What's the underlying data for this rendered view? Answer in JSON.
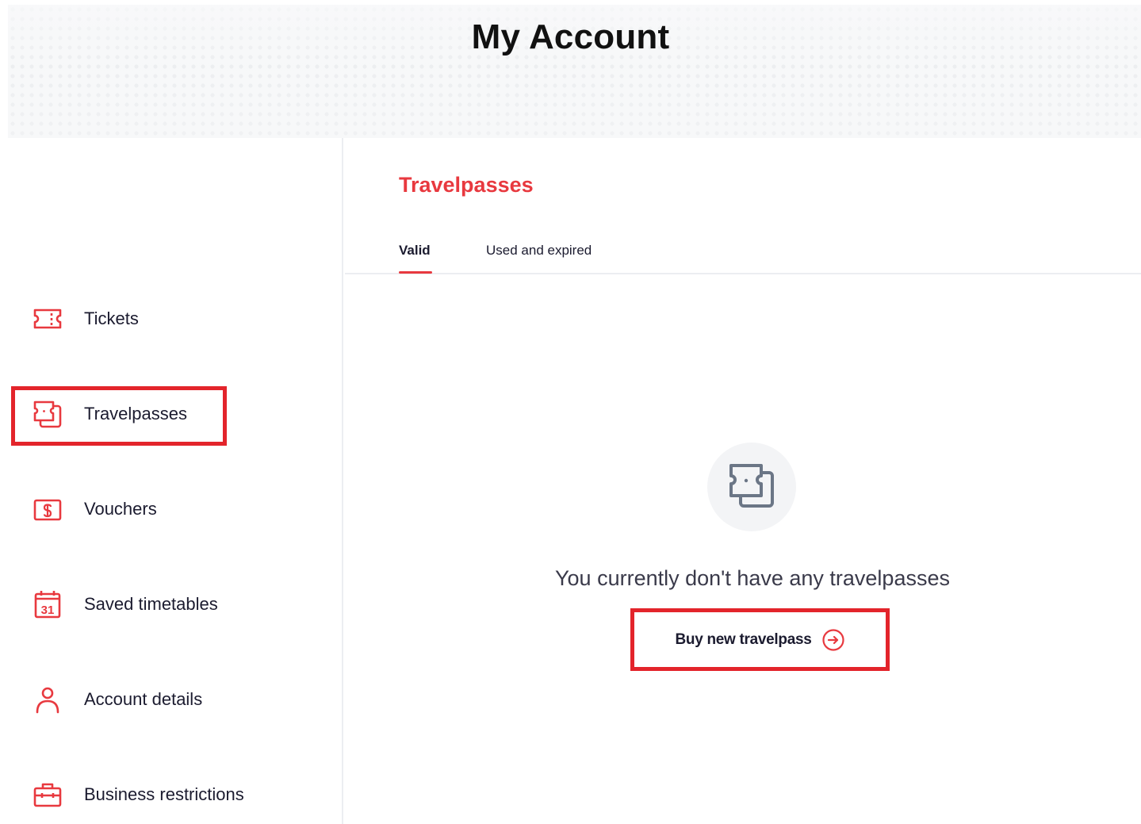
{
  "header": {
    "title": "My Account"
  },
  "colors": {
    "accent": "#e8393f",
    "highlight": "#e3242b",
    "text": "#1b1b2f",
    "muted_icon": "#6b7686"
  },
  "sidebar": {
    "items": [
      {
        "label": "Tickets",
        "icon": "ticket-icon"
      },
      {
        "label": "Travelpasses",
        "icon": "travelpass-icon",
        "active": true
      },
      {
        "label": "Vouchers",
        "icon": "voucher-icon"
      },
      {
        "label": "Saved timetables",
        "icon": "calendar-icon"
      },
      {
        "label": "Account details",
        "icon": "user-icon"
      },
      {
        "label": "Business restrictions",
        "icon": "briefcase-icon"
      }
    ]
  },
  "main": {
    "section_title": "Travelpasses",
    "tabs": [
      {
        "label": "Valid",
        "active": true
      },
      {
        "label": "Used and expired",
        "active": false
      }
    ],
    "empty_state": {
      "icon": "travelpass-icon",
      "message": "You currently don't have any travelpasses",
      "button_label": "Buy new travelpass",
      "button_icon": "arrow-right-circle-icon"
    }
  }
}
